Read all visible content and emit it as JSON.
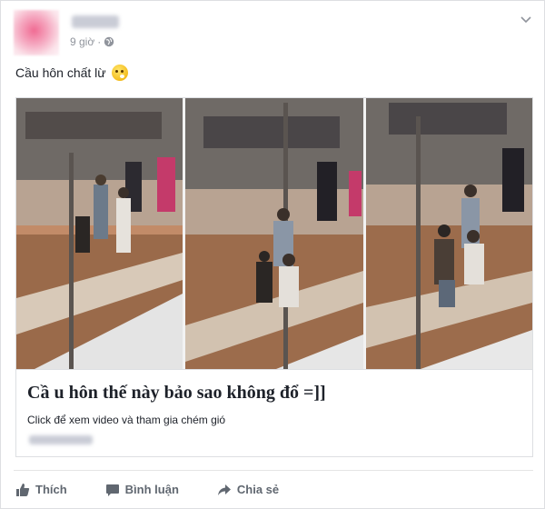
{
  "post": {
    "author_name": "",
    "timestamp": "9 giờ",
    "separator": "·",
    "caption": "Cầu hôn chất lừ",
    "emoji": "grinning-face-emoji"
  },
  "card": {
    "title": "Cầ u hôn thế  này bảo sao không đổ =]]",
    "description": "Click để xem video và tham gia chém gió",
    "domain": ""
  },
  "actions": {
    "like_label": "Thích",
    "comment_label": "Bình luận",
    "share_label": "Chia sẻ"
  },
  "colors": {
    "text_primary": "#1d2129",
    "text_secondary": "#90949c",
    "action_gray": "#606770",
    "border": "#dddfe2"
  }
}
